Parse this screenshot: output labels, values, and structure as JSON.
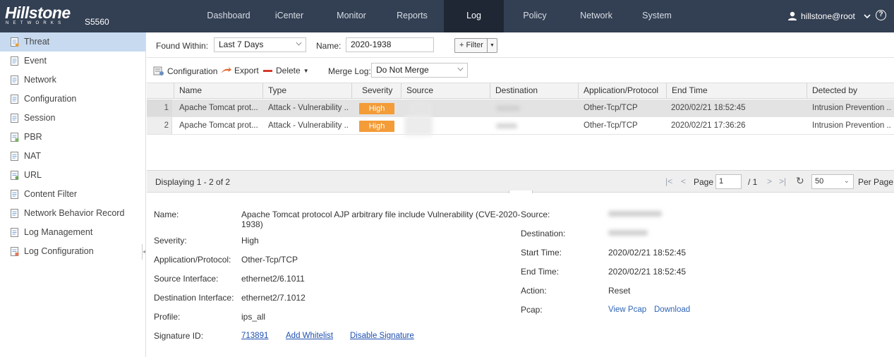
{
  "app": {
    "logo_main": "Hillstone",
    "logo_sub": "NETWORKS",
    "model": "S5560",
    "nav": [
      {
        "label": "Dashboard"
      },
      {
        "label": "iCenter"
      },
      {
        "label": "Monitor"
      },
      {
        "label": "Reports"
      },
      {
        "label": "Log",
        "active": true
      },
      {
        "label": "Policy"
      },
      {
        "label": "Network"
      },
      {
        "label": "System"
      }
    ],
    "user": "hillstone@root",
    "help": "?"
  },
  "sidebar": {
    "items": [
      {
        "label": "Threat",
        "active": true
      },
      {
        "label": "Event"
      },
      {
        "label": "Network"
      },
      {
        "label": "Configuration"
      },
      {
        "label": "Session"
      },
      {
        "label": "PBR"
      },
      {
        "label": "NAT"
      },
      {
        "label": "URL"
      },
      {
        "label": "Content Filter"
      },
      {
        "label": "Network Behavior Record"
      },
      {
        "label": "Log Management"
      },
      {
        "label": "Log Configuration"
      }
    ]
  },
  "filter": {
    "found_within_label": "Found Within:",
    "found_within_value": "Last 7 Days",
    "name_label": "Name:",
    "name_value": "2020-1938",
    "filter_button": "+ Filter"
  },
  "toolbar": {
    "configuration": "Configuration",
    "export": "Export",
    "delete": "Delete",
    "merge_label": "Merge Log:",
    "merge_value": "Do Not Merge"
  },
  "grid": {
    "columns": [
      "Name",
      "Type",
      "Severity",
      "Source",
      "Destination",
      "Application/Protocol",
      "End Time",
      "Detected by"
    ],
    "rows": [
      {
        "num": "1",
        "name": "Apache Tomcat prot...",
        "type": "Attack - Vulnerability ...",
        "severity": "High",
        "app": "Other-Tcp/TCP",
        "end_time": "2020/02/21 18:52:45",
        "detected_by": "Intrusion Prevention ..."
      },
      {
        "num": "2",
        "name": "Apache Tomcat prot...",
        "type": "Attack - Vulnerability ...",
        "severity": "High",
        "app": "Other-Tcp/TCP",
        "end_time": "2020/02/21 17:36:26",
        "detected_by": "Intrusion Prevention ..."
      }
    ]
  },
  "pager": {
    "display_text": "Displaying 1 - 2 of 2",
    "page_label": "Page",
    "page_value": "1",
    "page_total": "/ 1",
    "per_page_value": "50",
    "per_page_label": "Per Page"
  },
  "detail": {
    "left": [
      {
        "label": "Name:",
        "value": "Apache Tomcat protocol AJP arbitrary file include Vulnerability (CVE-2020-1938)"
      },
      {
        "label": "Severity:",
        "value": "High"
      },
      {
        "label": "Application/Protocol:",
        "value": "Other-Tcp/TCP"
      },
      {
        "label": "Source Interface:",
        "value": "ethernet2/6.1011"
      },
      {
        "label": "Destination Interface:",
        "value": "ethernet2/7.1012"
      },
      {
        "label": "Profile:",
        "value": "ips_all"
      },
      {
        "label": "Signature ID:",
        "value": "713891"
      }
    ],
    "signature_links": {
      "whitelist": "Add Whitelist",
      "disable": "Disable Signature"
    },
    "right": [
      {
        "label": "Source:"
      },
      {
        "label": "Destination:"
      },
      {
        "label": "Start Time:",
        "value": "2020/02/21 18:52:45"
      },
      {
        "label": "End Time:",
        "value": "2020/02/21 18:52:45"
      },
      {
        "label": "Action:",
        "value": "Reset"
      },
      {
        "label": "Pcap:"
      }
    ],
    "pcap_links": {
      "view": "View Pcap",
      "download": "Download"
    }
  },
  "colors": {
    "topbar": "#333f52",
    "active_nav": "#1f2735",
    "sidebar_active": "#c7daf0",
    "severity_high": "#f39c38",
    "link": "#2f66b8"
  }
}
